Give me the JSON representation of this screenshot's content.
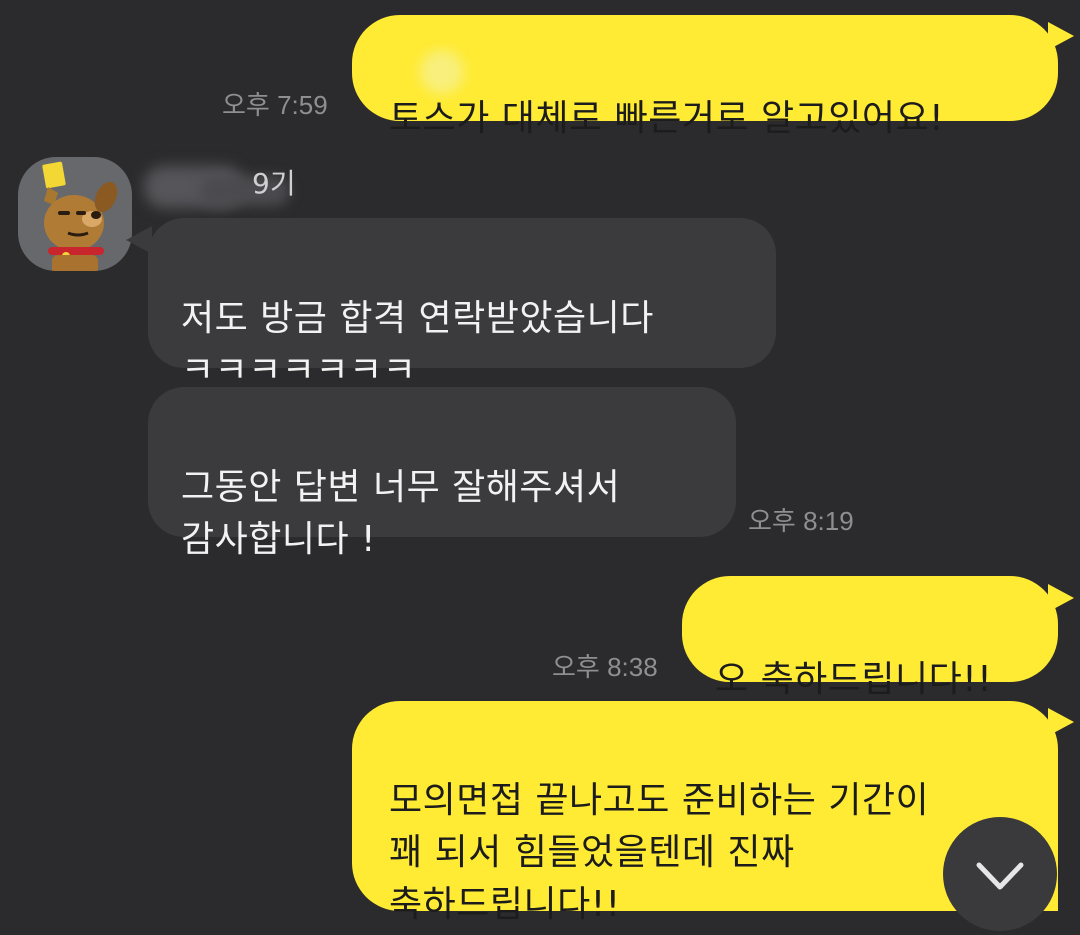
{
  "messages": [
    {
      "direction": "outgoing",
      "text": "토스가 대체로 빠른거로 알고있어요!"
    },
    {
      "direction": "incoming",
      "text": "저도 방금 합격 연락받았습니다\nㅋㅋㅋㅋㅋㅋㅋ"
    },
    {
      "direction": "incoming",
      "text": "그동안 답변 너무 잘해주셔서\n감사합니다 !"
    },
    {
      "direction": "outgoing",
      "text": "오 축하드립니다!!"
    },
    {
      "direction": "outgoing",
      "text": "모의면접 끝나고도 준비하는 기간이\n꽤 되서 힘들었을텐데 진짜\n축하드립니다!!"
    }
  ],
  "timestamps": [
    "오후 7:59",
    "오후 8:19",
    "오후 8:38"
  ],
  "sender": {
    "name_suffix": "9기",
    "avatar_icon": "dog-character-avatar-icon"
  },
  "scroll_button": {
    "icon": "chevron-down-icon"
  },
  "colors": {
    "background": "#2b2b2d",
    "outgoing_bubble": "#ffeb33",
    "incoming_bubble": "#3b3b3e",
    "timestamp_text": "#8e8e93"
  }
}
